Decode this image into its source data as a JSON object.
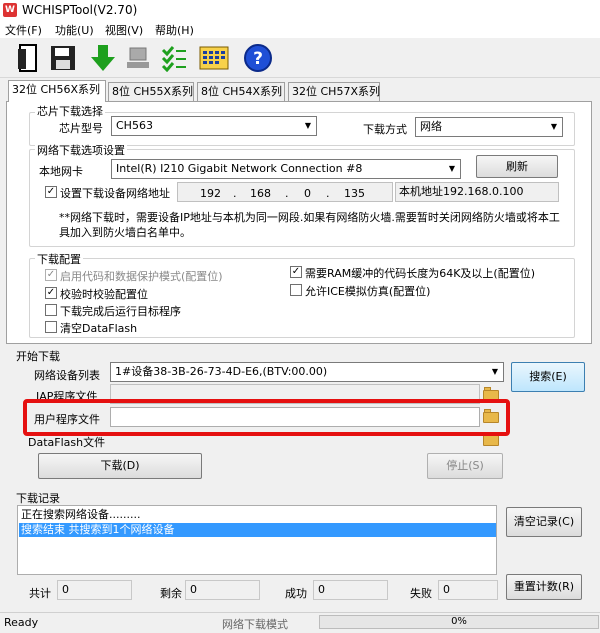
{
  "app": {
    "title": "WCHISPTool(V2.70)"
  },
  "menu": {
    "file": "文件(F)",
    "function": "功能(U)",
    "view": "视图(V)",
    "help": "帮助(H)"
  },
  "tabs": [
    "32位 CH56X系列",
    "8位 CH55X系列",
    "8位 CH54X系列",
    "32位 CH57X系列"
  ],
  "chip": {
    "group": "芯片下载选择",
    "model_label": "芯片型号",
    "model_value": "CH563",
    "mode_label": "下载方式",
    "mode_value": "网络"
  },
  "net": {
    "group": "网络下载选项设置",
    "nic_label": "本地网卡",
    "nic_value": "Intel(R) I210 Gigabit Network Connection #8",
    "refresh": "刷新",
    "ip_checkbox_label": "设置下载设备网络地址",
    "ip": [
      "192",
      "168",
      "0",
      "135"
    ],
    "dot": ".",
    "local_ip_label": "本机地址192.168.0.100",
    "note": "**网络下载时，需要设备IP地址与本机为同一网段.如果有网络防火墙.需要暂时关闭网络防火墙或将本工具加入到防火墙白名单中。"
  },
  "config": {
    "group": "下载配置",
    "opt1": "启用代码和数据保护模式(配置位)",
    "opt2": "校验时校验配置位",
    "opt3": "下载完成后运行目标程序",
    "opt4": "清空DataFlash",
    "opt5": "需要RAM缓冲的代码长度为64K及以上(配置位)",
    "opt6": "允许ICE模拟仿真(配置位)"
  },
  "download": {
    "group": "开始下载",
    "dev_list_label": "网络设备列表",
    "dev_list_value": "1#设备38-3B-26-73-4D-E6,(BTV:00.00)",
    "search": "搜索(E)",
    "iap_label": "IAP程序文件",
    "user_label": "用户程序文件",
    "dataflash_label": "DataFlash文件",
    "download_btn": "下载(D)",
    "stop_btn": "停止(S)"
  },
  "log": {
    "group": "下载记录",
    "lines": [
      "正在搜索网络设备.........",
      "搜索结束 共搜索到1个网络设备"
    ],
    "clear": "清空记录(C)"
  },
  "stats": {
    "total_label": "共计",
    "total": "0",
    "remain_label": "剩余",
    "remain": "0",
    "success_label": "成功",
    "success": "0",
    "fail_label": "失败",
    "fail": "0",
    "reset": "重置计数(R)"
  },
  "status": {
    "ready": "Ready",
    "mode": "网络下载模式",
    "progress": "0%"
  }
}
